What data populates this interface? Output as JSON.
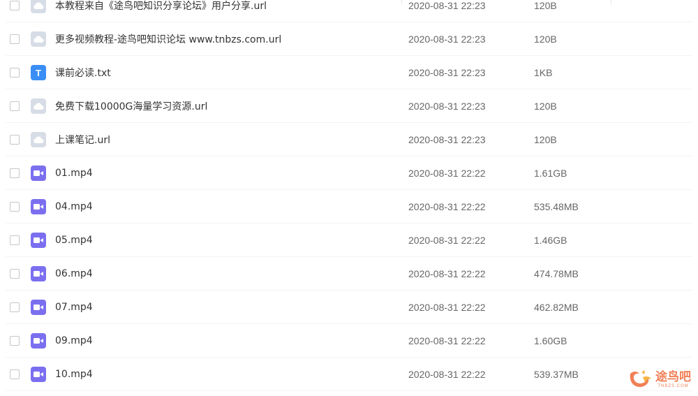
{
  "files": [
    {
      "name": "本教程来自《途鸟吧知识分享论坛》用户分享.url",
      "date": "2020-08-31 22:23",
      "size": "120B",
      "type": "url"
    },
    {
      "name": "更多视频教程-途鸟吧知识论坛 www.tnbzs.com.url",
      "date": "2020-08-31 22:23",
      "size": "120B",
      "type": "url"
    },
    {
      "name": "课前必读.txt",
      "date": "2020-08-31 22:23",
      "size": "1KB",
      "type": "txt",
      "icon_letter": "T"
    },
    {
      "name": "免费下载10000G海量学习资源.url",
      "date": "2020-08-31 22:23",
      "size": "120B",
      "type": "url"
    },
    {
      "name": "上课笔记.url",
      "date": "2020-08-31 22:23",
      "size": "120B",
      "type": "url"
    },
    {
      "name": "01.mp4",
      "date": "2020-08-31 22:22",
      "size": "1.61GB",
      "type": "video"
    },
    {
      "name": "04.mp4",
      "date": "2020-08-31 22:22",
      "size": "535.48MB",
      "type": "video"
    },
    {
      "name": "05.mp4",
      "date": "2020-08-31 22:22",
      "size": "1.46GB",
      "type": "video"
    },
    {
      "name": "06.mp4",
      "date": "2020-08-31 22:22",
      "size": "474.78MB",
      "type": "video"
    },
    {
      "name": "07.mp4",
      "date": "2020-08-31 22:22",
      "size": "462.82MB",
      "type": "video"
    },
    {
      "name": "09.mp4",
      "date": "2020-08-31 22:22",
      "size": "1.60GB",
      "type": "video"
    },
    {
      "name": "10.mp4",
      "date": "2020-08-31 22:22",
      "size": "539.37MB",
      "type": "video"
    }
  ],
  "watermark": {
    "main": "途鸟吧",
    "sub": "TNBZS.COM"
  },
  "colors": {
    "url_icon": "#d7dde6",
    "txt_icon": "#3a8ef6",
    "video_icon": "#7b6ff0",
    "watermark": "#ef6a3a"
  }
}
